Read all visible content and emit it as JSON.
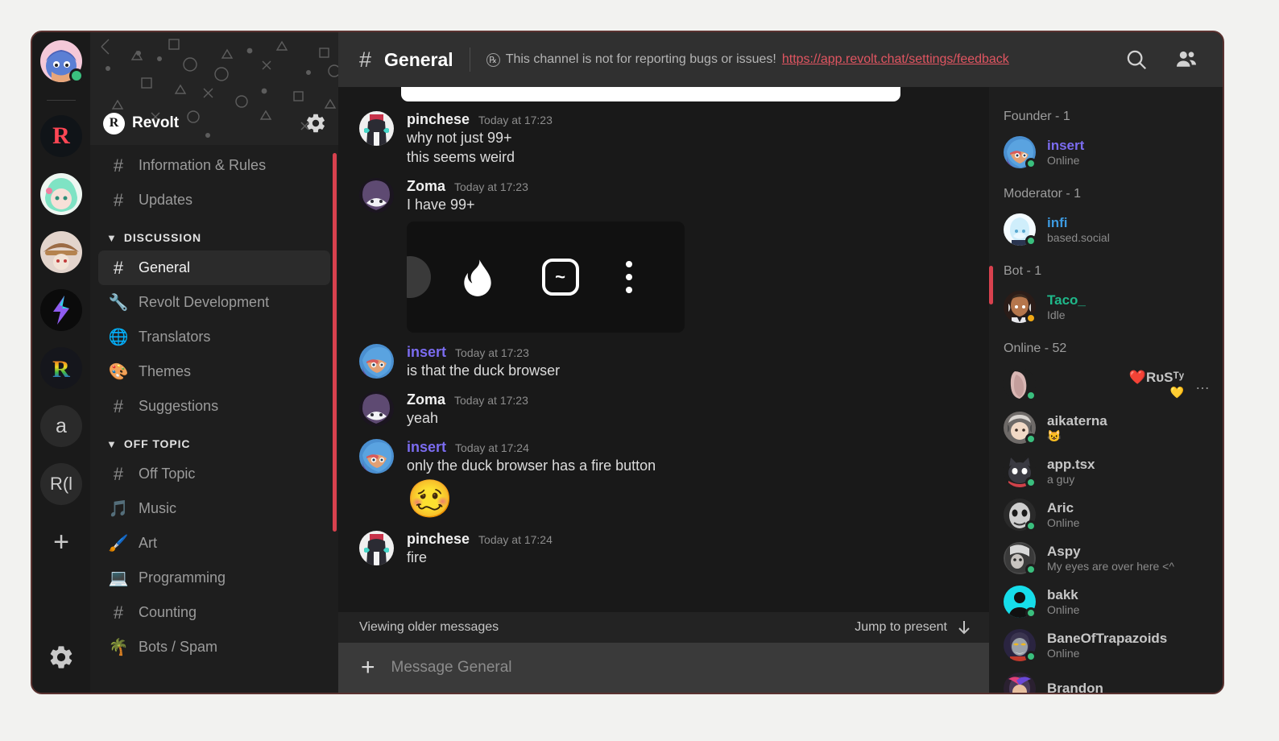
{
  "app": {
    "name": "Revolt"
  },
  "server_rail": {
    "user_avatar": {
      "name": "user-avatar",
      "status": "online"
    },
    "servers": [
      {
        "label": "R",
        "name": "revolt-lounge",
        "type": "letter",
        "color": "#ff4654",
        "bg": "#101418"
      },
      {
        "label": "",
        "name": "server-mint",
        "type": "image",
        "bg": "#d9f2e6"
      },
      {
        "label": "",
        "name": "server-mage",
        "type": "image",
        "bg": "#c9b39a"
      },
      {
        "label": "",
        "name": "server-bolt",
        "type": "image",
        "bg": "#0b0b0b"
      },
      {
        "label": "R",
        "name": "server-pride",
        "type": "pride",
        "bg": "#15161c"
      },
      {
        "label": "a",
        "name": "server-a",
        "type": "letter",
        "color": "#e8e8e8",
        "bg": "#2a2a2a"
      },
      {
        "label": "R(l",
        "name": "server-rl",
        "type": "letter",
        "color": "#e8e8e8",
        "bg": "#2a2a2a"
      }
    ],
    "add_server_label": "+",
    "settings_label": "Settings"
  },
  "sidebar": {
    "server_name": "Revolt",
    "server_logo_letter": "R",
    "items": [
      {
        "type": "channel",
        "icon": "hash",
        "label": "Information & Rules",
        "active": false
      },
      {
        "type": "channel",
        "icon": "hash",
        "label": "Updates",
        "active": false
      },
      {
        "type": "category",
        "label": "DISCUSSION"
      },
      {
        "type": "channel",
        "icon": "hash",
        "label": "General",
        "active": true
      },
      {
        "type": "channel",
        "icon": "🔧",
        "label": "Revolt Development",
        "active": false
      },
      {
        "type": "channel",
        "icon": "🌐",
        "label": "Translators",
        "active": false
      },
      {
        "type": "channel",
        "icon": "🎨",
        "label": "Themes",
        "active": false
      },
      {
        "type": "channel",
        "icon": "hash",
        "label": "Suggestions",
        "active": false
      },
      {
        "type": "category",
        "label": "OFF TOPIC"
      },
      {
        "type": "channel",
        "icon": "hash",
        "label": "Off Topic",
        "active": false
      },
      {
        "type": "channel",
        "icon": "🎵",
        "label": "Music",
        "active": false
      },
      {
        "type": "channel",
        "icon": "🖌️",
        "label": "Art",
        "active": false
      },
      {
        "type": "channel",
        "icon": "💻",
        "label": "Programming",
        "active": false
      },
      {
        "type": "channel",
        "icon": "hash",
        "label": "Counting",
        "active": false
      },
      {
        "type": "channel",
        "icon": "🌴",
        "label": "Bots / Spam",
        "active": false
      }
    ]
  },
  "header": {
    "hash": "#",
    "title": "General",
    "description": "This channel is not for reporting bugs or issues!",
    "link": "https://app.revolt.chat/settings/feedback",
    "search_icon": "search-icon",
    "members_icon": "members-icon"
  },
  "messages": [
    {
      "author": "pinchese",
      "accent": false,
      "time": "Today at 17:23",
      "lines": [
        "why not just 99+",
        "this seems weird"
      ],
      "attachment": null,
      "emoji": null
    },
    {
      "author": "Zoma",
      "accent": false,
      "time": "Today at 17:23",
      "lines": [
        "I have 99+"
      ],
      "attachment": {
        "type": "browser-toolbar",
        "fire": "fire-icon",
        "tilde": "~",
        "menu": "more-vertical-icon"
      },
      "emoji": null
    },
    {
      "author": "insert",
      "accent": true,
      "time": "Today at 17:23",
      "lines": [
        "is that the duck browser"
      ],
      "attachment": null,
      "emoji": null
    },
    {
      "author": "Zoma",
      "accent": false,
      "time": "Today at 17:23",
      "lines": [
        "yeah"
      ],
      "attachment": null,
      "emoji": null
    },
    {
      "author": "insert",
      "accent": true,
      "time": "Today at 17:24",
      "lines": [
        "only the duck browser has a fire button"
      ],
      "attachment": null,
      "emoji": "🥴"
    },
    {
      "author": "pinchese",
      "accent": false,
      "time": "Today at 17:24",
      "lines": [
        "fire"
      ],
      "attachment": null,
      "emoji": null
    }
  ],
  "older_bar": {
    "label": "Viewing older messages",
    "jump_label": "Jump to present",
    "jump_icon": "arrow-down-icon"
  },
  "composer": {
    "plus_icon": "plus-icon",
    "placeholder": "Message General",
    "value": ""
  },
  "member_list": {
    "groups": [
      {
        "title": "Founder - 1",
        "members": [
          {
            "name": "insert",
            "sub": "Online",
            "status": "online",
            "color": "purple",
            "avatar": "insert"
          }
        ]
      },
      {
        "title": "Moderator - 1",
        "members": [
          {
            "name": "infi",
            "sub": "based.social",
            "status": "online",
            "color": "blue",
            "avatar": "infi"
          }
        ]
      },
      {
        "title": "Bot - 1",
        "members": [
          {
            "name": "Taco_",
            "sub": "Idle",
            "status": "idle",
            "color": "green",
            "avatar": "taco"
          }
        ]
      },
      {
        "title": "Online - 52",
        "members": [
          {
            "name": "❤️RᴜSᵀʸ",
            "sub": "💛",
            "status": "online",
            "color": "default",
            "avatar": "rusty",
            "rich": true,
            "trailing": "…"
          },
          {
            "name": "aikaterna",
            "sub": "😺",
            "status": "online",
            "color": "default",
            "avatar": "aikaterna"
          },
          {
            "name": "app.tsx",
            "sub": "a guy",
            "status": "online",
            "color": "default",
            "avatar": "apptsx"
          },
          {
            "name": "Aric",
            "sub": "Online",
            "status": "online",
            "color": "default",
            "avatar": "aric"
          },
          {
            "name": "Aspy",
            "sub": "My eyes are over here <^",
            "status": "online",
            "color": "default",
            "avatar": "aspy"
          },
          {
            "name": "bakk",
            "sub": "Online",
            "status": "online",
            "color": "default",
            "avatar": "bakk"
          },
          {
            "name": "BaneOfTrapazoids",
            "sub": "Online",
            "status": "online",
            "color": "default",
            "avatar": "bane"
          },
          {
            "name": "Brandon",
            "sub": "",
            "status": "online",
            "color": "default",
            "avatar": "brandon"
          }
        ]
      }
    ]
  },
  "colors": {
    "accent_red": "#d8414e",
    "link_red": "#e05561",
    "online_green": "#3abf7e",
    "idle_yellow": "#f0a815",
    "username_purple": "#7b6cf0",
    "username_blue": "#3d9ae0",
    "username_green": "#1fb88a",
    "window_border": "#5a3230",
    "header_bg": "#303030",
    "sidebar_bg": "#1e1e1e",
    "chat_bg": "#191919"
  }
}
